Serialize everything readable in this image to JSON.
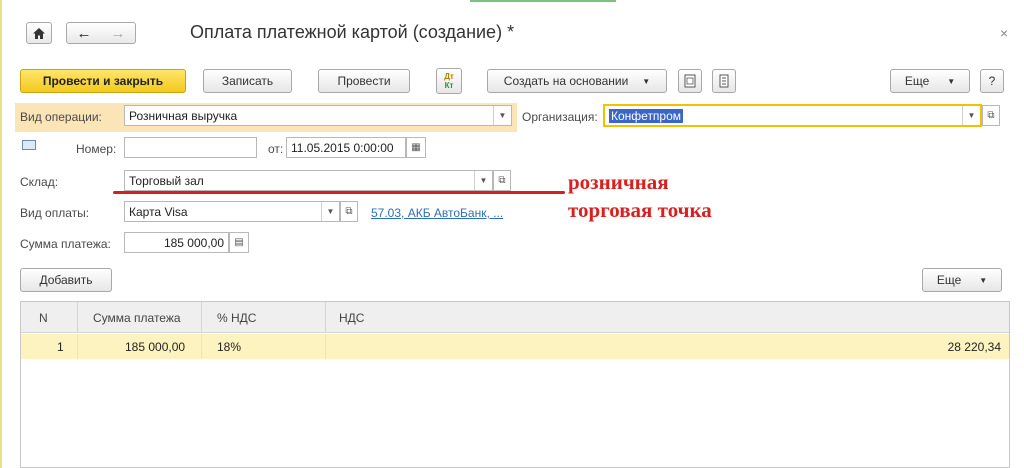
{
  "window": {
    "title": "Оплата платежной картой (создание) *",
    "home_icon": "home-icon",
    "back_icon": "arrow-left-icon",
    "forward_icon": "arrow-right-icon",
    "close_glyph": "×"
  },
  "toolbar": {
    "post_close": "Провести и закрыть",
    "save": "Записать",
    "post": "Провести",
    "dt_kt_top": "Дт",
    "dt_kt_bottom": "Кт",
    "create_based": "Создать на основании",
    "more": "Еще",
    "help": "?"
  },
  "form": {
    "operation_label": "Вид операции:",
    "operation_value": "Розничная выручка",
    "org_label": "Организация:",
    "org_value": "Конфетпром",
    "number_label": "Номер:",
    "number_value": "",
    "date_label": "от:",
    "date_value": "11.05.2015  0:00:00",
    "warehouse_label": "Склад:",
    "warehouse_value": "Торговый зал",
    "payment_label": "Вид оплаты:",
    "payment_value": "Карта Visa",
    "payment_link": "57.03, АКБ АвтоБанк, ...",
    "sum_label": "Сумма платежа:",
    "sum_value": "185 000,00"
  },
  "annotation": {
    "line1": "розничная",
    "line2": "торговая точка",
    "color": "#d92020"
  },
  "table_toolbar": {
    "add": "Добавить",
    "more": "Еще"
  },
  "table": {
    "columns": [
      "N",
      "Сумма платежа",
      "% НДС",
      "НДС"
    ],
    "rows": [
      {
        "n": "1",
        "sum": "185 000,00",
        "vat_rate": "18%",
        "vat": "28 220,34"
      }
    ]
  },
  "colors": {
    "primary_button": "#f3c91c",
    "highlight": "#fbe5b6",
    "link": "#2c6fb7",
    "selected_row": "#fdf3c1"
  }
}
